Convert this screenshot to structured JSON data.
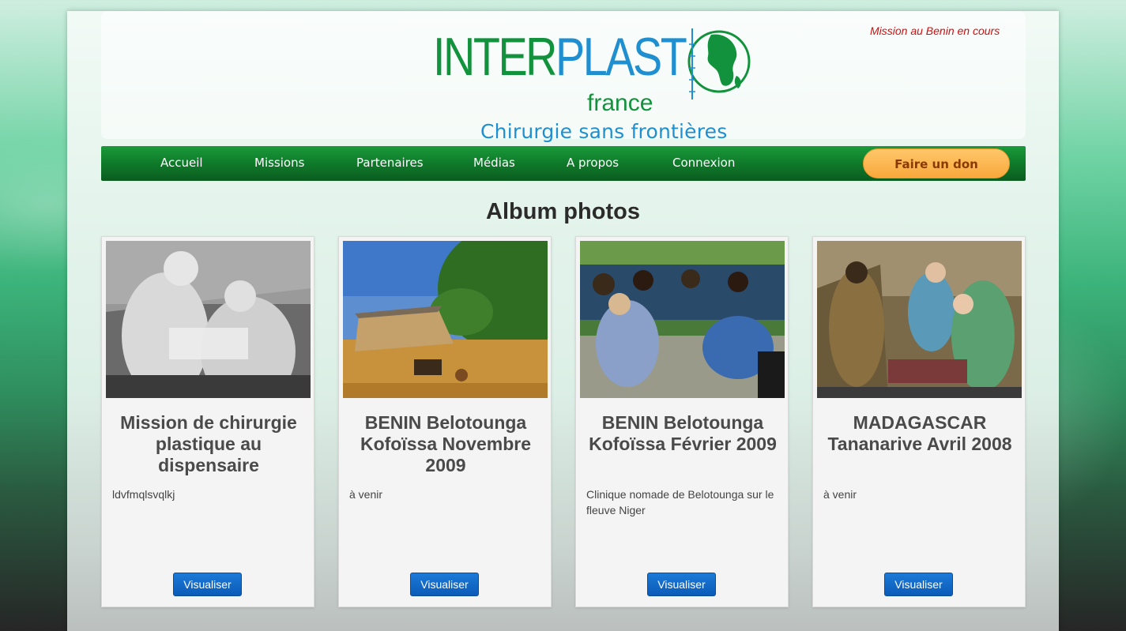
{
  "header": {
    "logo": {
      "inter": "INTER",
      "plast": "PLAST",
      "france": "france"
    },
    "tagline": "Chirurgie sans frontières",
    "mission_note": "Mission au Benin en cours"
  },
  "nav": {
    "items": [
      "Accueil",
      "Missions",
      "Partenaires",
      "Médias",
      "A propos",
      "Connexion"
    ],
    "donate": "Faire un don"
  },
  "album": {
    "title": "Album photos",
    "cards": [
      {
        "title": "Mission de chirurgie plastique au dispensaire",
        "description": "ldvfmqlsvqlkj",
        "button": "Visualiser"
      },
      {
        "title": "BENIN Belotounga Kofoïssa Novembre 2009",
        "description": "à venir",
        "button": "Visualiser"
      },
      {
        "title": "BENIN Belotounga Kofoïssa Février 2009",
        "description": "Clinique nomade de Belotounga sur le fleuve Niger",
        "button": "Visualiser"
      },
      {
        "title": "MADAGASCAR Tananarive Avril 2008",
        "description": "à venir",
        "button": "Visualiser"
      }
    ]
  },
  "colors": {
    "nav_green": "#0f7a2a",
    "logo_green": "#12923c",
    "logo_blue": "#1f8fcf",
    "donate_orange": "#f9a83c",
    "mission_note_red": "#cc1111",
    "button_blue": "#0b5bb8"
  }
}
